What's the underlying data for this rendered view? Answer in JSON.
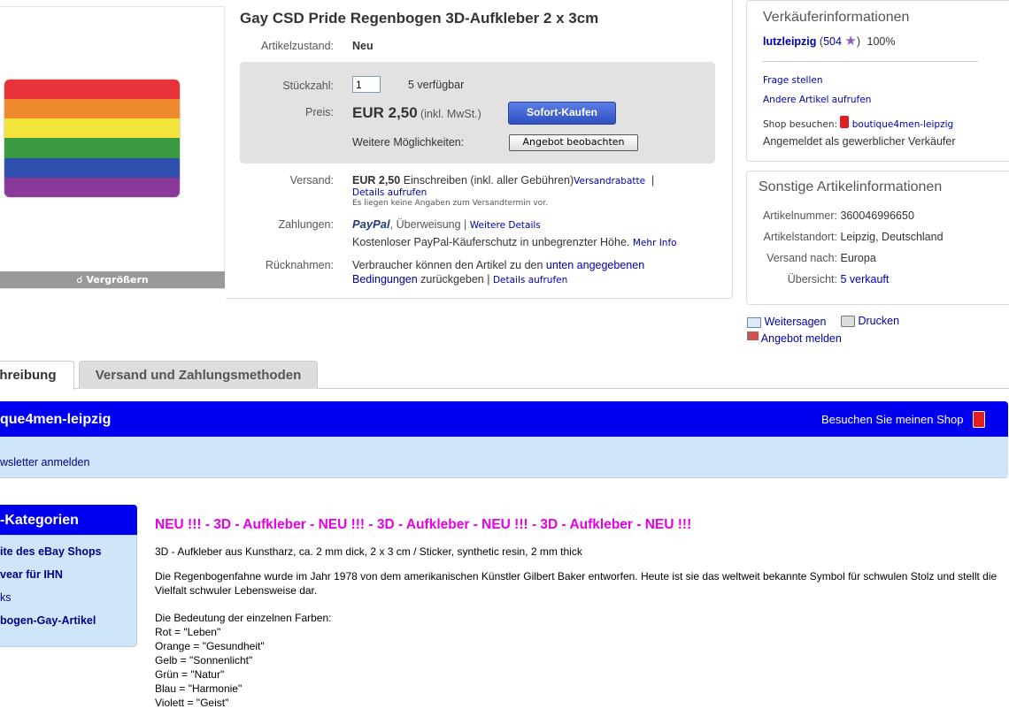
{
  "item": {
    "title": "Gay CSD Pride Regenbogen 3D-Aufkleber 2 x 3cm",
    "condition_label": "Artikelzustand:",
    "condition_value": "Neu",
    "qty_label": "Stückzahl:",
    "qty_value": "1",
    "available": "5 verfügbar",
    "price_label": "Preis:",
    "price_value": "EUR 2,50",
    "price_note": "(inkl. MwSt.)",
    "buy_button": "Sofort-Kaufen",
    "more_options_label": "Weitere Möglichkeiten:",
    "watch_button": "Angebot beobachten",
    "shipping_label": "Versand:",
    "shipping_value": "EUR 2,50",
    "shipping_desc": "Einschreiben (inkl. aller Gebühren)",
    "shipping_discount_link": "Versandrabatte",
    "shipping_details_link": "Details aufrufen",
    "shipping_note": "Es liegen keine Angaben zum Versandtermin vor.",
    "payment_label": "Zahlungen:",
    "payment_logo": "PayPal",
    "payment_methods": ", Überweisung |",
    "payment_more_link": "Weitere Details",
    "payment_protection": "Kostenloser PayPal-Käuferschutz in unbegrenzter Höhe.",
    "payment_more_info_link": "Mehr Info",
    "returns_label": "Rücknahmen:",
    "returns_text_1": "Verbraucher können den Artikel zu den",
    "returns_link": "unten angegebenen",
    "returns_link_2": "Bedingungen",
    "returns_text_2": "zurückgeben |",
    "returns_details_link": "Details aufrufen",
    "zoom_label": "Vergrößern"
  },
  "seller": {
    "title": "Verkäuferinformationen",
    "name": "lutzleipzig",
    "score": "504",
    "positive": "100%",
    "ask_question": "Frage stellen",
    "other_items": "Andere Artikel aufrufen",
    "shop_label": "Shop besuchen:",
    "shop_name": "boutique4men-leipzig",
    "seller_type": "Angemeldet als gewerblicher Verkäufer"
  },
  "other_info": {
    "title": "Sonstige Artikelinformationen",
    "rows": [
      {
        "label": "Artikelnummer:",
        "value": "360046996650"
      },
      {
        "label": "Artikelstandort:",
        "value": "Leipzig, Deutschland"
      },
      {
        "label": "Versand nach:",
        "value": "Europa"
      },
      {
        "label": "Übersicht:",
        "value": "5 verkauft"
      }
    ]
  },
  "actions": {
    "share": "Weitersagen",
    "print": "Drucken",
    "report": "Angebot melden"
  },
  "tabs": [
    {
      "label": "chreibung"
    },
    {
      "label": "Versand und Zahlungsmethoden"
    }
  ],
  "shop": {
    "name": "que4men-leipzig",
    "visit": "Besuchen Sie meinen Shop",
    "newsletter": "wsletter anmelden"
  },
  "categories": {
    "title": "-Kategorien",
    "items": [
      "ite des eBay Shops",
      "vear für IHN",
      "ks",
      "bogen-Gay-Artikel"
    ]
  },
  "description": {
    "headline": "NEU !!!  - 3D - Aufkleber - NEU !!!  - 3D - Aufkleber - NEU !!!  - 3D - Aufkleber - NEU !!!",
    "line1": "3D - Aufkleber aus Kunstharz, ca. 2 mm dick, 2 x 3 cm / Sticker, synthetic resin, 2 mm thick",
    "para2": "Die Regenbogenfahne wurde im Jahr 1978 von dem amerikanischen Künstler Gilbert Baker entworfen. Heute ist sie das weltweit bekannte Symbol für schwulen Stolz und stellt die Vielfalt schwuler Lebensweise dar.",
    "colors_title": "Die Bedeutung der einzelnen Farben:",
    "colors": [
      "Rot = \"Leben\"",
      "Orange = \"Gesundheit\"",
      "Gelb = \"Sonnenlicht\"",
      "Grün = \"Natur\"",
      "Blau = \"Harmonie\"",
      "Violett = \"Geist\""
    ]
  },
  "flag_colors": [
    "#e8333a",
    "#f08a2e",
    "#f2e43a",
    "#3a9a40",
    "#2f4fb0",
    "#8b3a9a"
  ]
}
